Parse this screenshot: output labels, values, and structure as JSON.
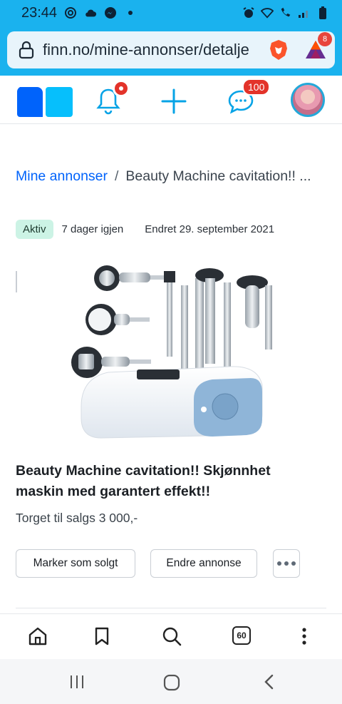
{
  "status_bar": {
    "time": "23:44",
    "icons": [
      "at-icon",
      "cloud-icon",
      "messenger-icon",
      "dot-icon"
    ],
    "right_icons": [
      "alarm-icon",
      "wifi-icon",
      "wifi-call-icon",
      "signal-icon",
      "battery-icon"
    ]
  },
  "browser": {
    "url": "finn.no/mine-annonser/detalje",
    "bat_badge": "8"
  },
  "finn_header": {
    "chat_badge": "100"
  },
  "breadcrumb": {
    "parent": "Mine annonser",
    "separator": "/",
    "current": "Beauty Machine cavitation!! ..."
  },
  "ad": {
    "status": "Aktiv",
    "days_left": "7 dager igjen",
    "changed": "Endret 29. september 2021",
    "title": "Beauty Machine cavitation!! Skjønnhet maskin med garantert effekt!!",
    "price_line": "Torget til salgs 3 000,-"
  },
  "actions": {
    "mark_sold": "Marker som solgt",
    "edit": "Endre annonse"
  },
  "bottom_nav": {
    "tabs_count": "60"
  },
  "colors": {
    "browser_bar": "#1ab2ee",
    "finn_blue": "#0063fb",
    "logo_light": "#06bffc",
    "badge_red": "#e3332a",
    "aktiv_bg": "#ccf3e5"
  }
}
